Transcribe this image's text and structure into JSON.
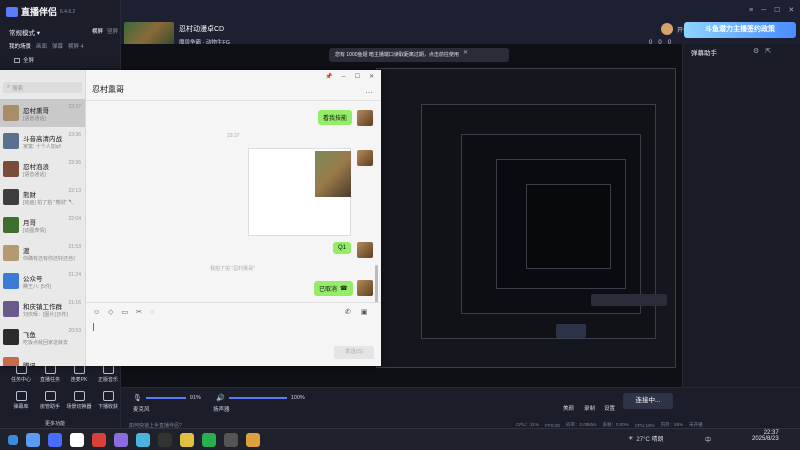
{
  "app": {
    "name": "直播伴侣",
    "version": "6.4.6.2"
  },
  "sidebar": {
    "mode": "常规模式 ▾",
    "tabs": [
      "横屏",
      "竖屏"
    ],
    "scene_tabs": [
      "我的场景",
      "画面",
      "弹幕",
      "横屏 4"
    ],
    "fullscreen": "全屏",
    "tools_row1": [
      "任务中心",
      "直播任务",
      "连麦PK",
      "正版音乐"
    ],
    "tools_row2": [
      "弹幕库",
      "房管助手",
      "场景切换器",
      "下播收获"
    ],
    "more": "更多功能"
  },
  "top": {
    "room_title": "忍村动漫卓CD",
    "category": "魔兽争霸 · 动物生FG",
    "subtitle": "动态直播",
    "launch_vote": "开播建议",
    "share": "分享",
    "stats": [
      "0",
      "0",
      "0"
    ],
    "promo": "斗鱼潜力主播签约政策"
  },
  "notice": {
    "text": "您有 1000鱼翅 暗主播端口读取距离过期，点击前往使用"
  },
  "right_panel": {
    "title": "弹幕助手"
  },
  "bottom": {
    "mic_label": "麦克风",
    "mic_pct": "91%",
    "speaker_label": "扬声器",
    "speaker_pct": "100%",
    "beauty": "美颜",
    "record": "录制",
    "settings": "设置",
    "start_btn": "连接中...",
    "hint": "如何快速上手直播伴侣?",
    "status": [
      "CPU：31%",
      "FPS:30",
      "码率：0.00kb/s",
      "丢帧：0.00%",
      "CPU:18%",
      "内存：55%",
      "未开播"
    ]
  },
  "chat": {
    "title": "忍村熏哥",
    "search_placeholder": "搜索",
    "contacts": [
      {
        "name": "忍村熏哥",
        "msg": "[语音通话]",
        "time": "23:37",
        "color": "#a98d6a"
      },
      {
        "name": "斗音高清内战",
        "msg": "家富: 十个人加q!!",
        "time": "23:36",
        "color": "#5b6f8f"
      },
      {
        "name": "忍村泡浪",
        "msg": "[语音通话]",
        "time": "22:36",
        "color": "#7a4c3a"
      },
      {
        "name": "熊财",
        "msg": "[动画] 拍了拍 \"熊财\" 🔪🔪🔪",
        "time": "22:13",
        "color": "#3e3e3e"
      },
      {
        "name": "月哥",
        "msg": "[动图表情]",
        "time": "22:04",
        "color": "#3f6f2e"
      },
      {
        "name": "渡",
        "msg": "你确有还有你还好还自己",
        "time": "21:53",
        "color": "#b59a71"
      },
      {
        "name": "公众号",
        "msg": "腾王八: [5件]",
        "time": "21:24",
        "color": "#3a7bd5"
      },
      {
        "name": "和庆镇工作群",
        "msg": "刘庆辉：[图片] [5件]",
        "time": "21:16",
        "color": "#6a5a8a"
      },
      {
        "name": "飞鱼",
        "msg": "吃饭点就回家这就去",
        "time": "20:53",
        "color": "#2b2b2b"
      },
      {
        "name": "腾讯",
        "msg": "",
        "time": "",
        "color": "#c86b4b"
      }
    ],
    "messages": {
      "m1": "看我技能",
      "time_label": "23:37",
      "q1": "Q1",
      "poke": "我拍了拍 \"忍村熏哥\"",
      "call": "已取消"
    },
    "send": "发送(S)"
  },
  "taskbar": {
    "weather": "27°C 晴朗",
    "time": "22:37",
    "date": "2025/8/23",
    "ime": "中"
  }
}
